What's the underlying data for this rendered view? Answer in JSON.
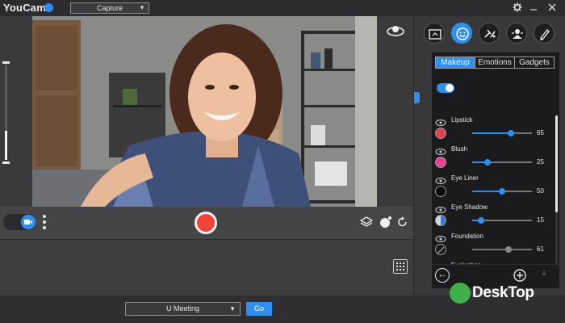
{
  "app": {
    "title": "YouCam"
  },
  "topbar": {
    "mode": "Capture"
  },
  "bottombar": {
    "meeting": "U Meeting",
    "go_label": "Go"
  },
  "effects": {
    "tabs": [
      "Makeup",
      "Emotions",
      "Gadgets"
    ],
    "active_tab": "Makeup",
    "enabled": true,
    "items": [
      {
        "label": "Lipstick",
        "value": "65",
        "level": 65,
        "color": "#e0434d",
        "icon": "lips-icon"
      },
      {
        "label": "Blush",
        "value": "25",
        "level": 25,
        "color": "#ea3f93",
        "icon": "blush-brush-icon"
      },
      {
        "label": "Eye Liner",
        "value": "50",
        "level": 50,
        "color": "#0a0a0a",
        "icon": "eye-icon"
      },
      {
        "label": "Eye Shadow",
        "value": "15",
        "level": 15,
        "color": "#3c7ac8",
        "icon": "eye-icon"
      },
      {
        "label": "Foundation",
        "value": "61",
        "level": 61,
        "color": "none",
        "icon": "face-icon",
        "disabled": true
      },
      {
        "label": "Eyelashes",
        "value": "",
        "level": 0,
        "color": "",
        "icon": "eye-icon"
      }
    ]
  },
  "watermark": {
    "text": "DeskTop"
  },
  "colors": {
    "accent": "#2f8ff0",
    "record": "#f24438"
  }
}
